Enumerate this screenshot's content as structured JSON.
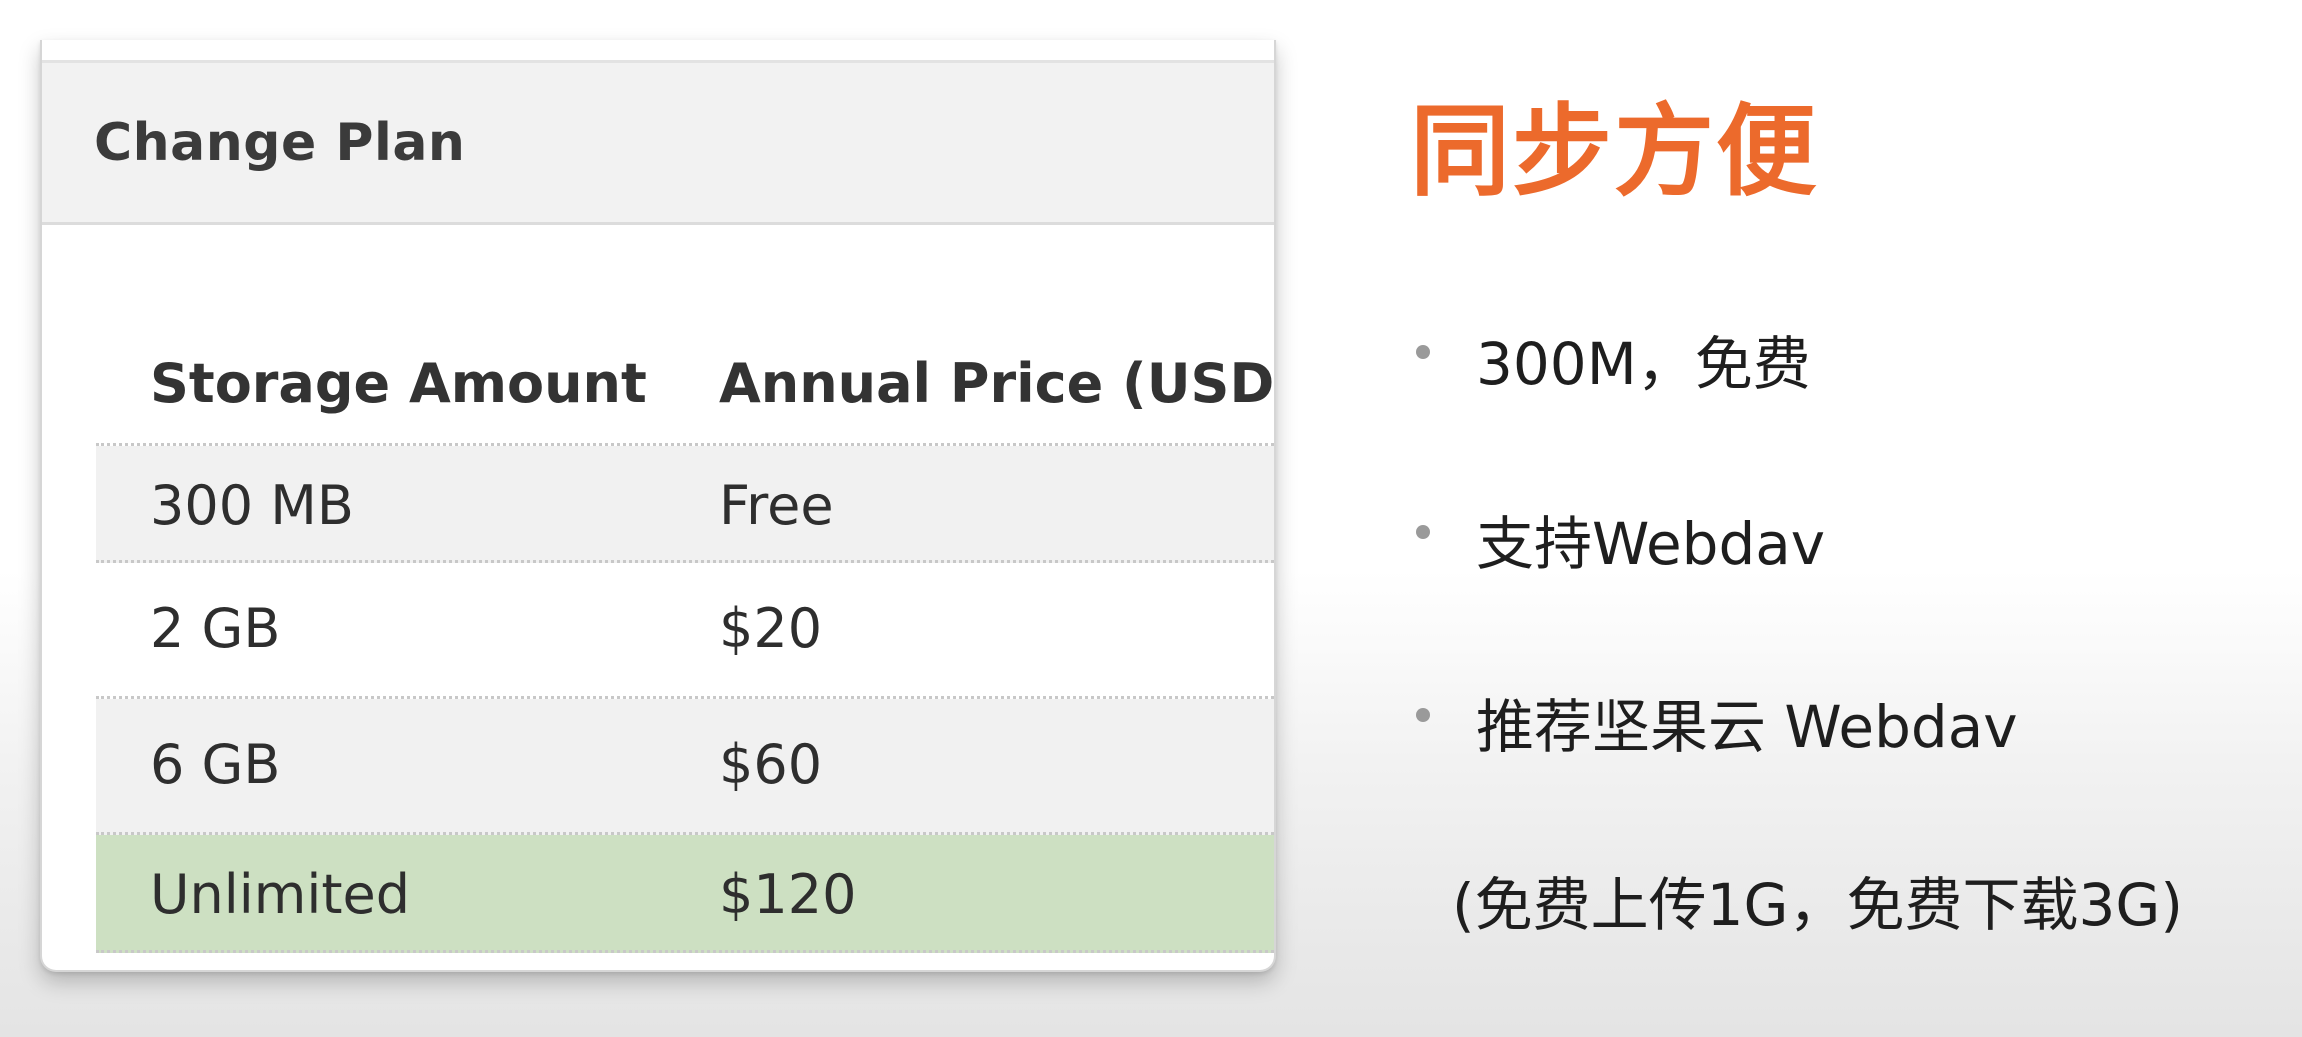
{
  "plan_dialog": {
    "title": "Change Plan",
    "columns": [
      "Storage Amount",
      "Annual Price (USD)"
    ],
    "rows": [
      {
        "storage": "300 MB",
        "price": "Free"
      },
      {
        "storage": "2 GB",
        "price": "$20"
      },
      {
        "storage": "6 GB",
        "price": "$60"
      },
      {
        "storage": "Unlimited",
        "price": "$120",
        "selected": true
      }
    ],
    "selected_row_color": "#cde0c2"
  },
  "slide": {
    "title": "同步方便",
    "title_color": "#ec6a2c",
    "bullets": [
      "300M，免费",
      "支持Webdav",
      "推荐坚果云 Webdav"
    ],
    "note": "(免费上传1G，免费下载3G)"
  }
}
